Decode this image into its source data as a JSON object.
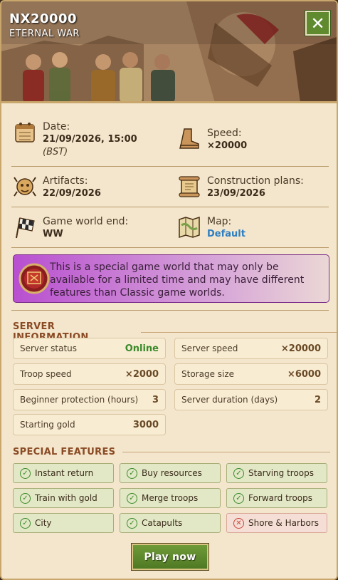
{
  "header": {
    "title": "NX20000",
    "subtitle": "ETERNAL WAR",
    "close_icon": "close-icon",
    "accent": "#5f8a2e"
  },
  "info": {
    "date": {
      "icon": "calendar-icon",
      "label": "Date:",
      "value": "21/09/2026, 15:00",
      "note": "(BST)"
    },
    "speed": {
      "icon": "boot-icon",
      "label": "Speed:",
      "value": "×20000"
    },
    "artifacts": {
      "icon": "artifact-mask-icon",
      "label": "Artifacts:",
      "value": "22/09/2026"
    },
    "construction_plans": {
      "icon": "scroll-icon",
      "label": "Construction plans:",
      "value": "23/09/2026"
    },
    "game_world_end": {
      "icon": "checkered-flag-icon",
      "label": "Game world end:",
      "value": "WW"
    },
    "map": {
      "icon": "map-icon",
      "label": "Map:",
      "value": "Default"
    }
  },
  "special_notice": {
    "icon": "special-world-badge-icon",
    "text": "This is a special game world that may only be available for a limited time and may have different features than Classic game worlds."
  },
  "server_information": {
    "heading": "SERVER INFORMATION",
    "stats": [
      {
        "label": "Server status",
        "value": "Online"
      },
      {
        "label": "Server speed",
        "value": "×20000"
      },
      {
        "label": "Troop speed",
        "value": "×2000"
      },
      {
        "label": "Storage size",
        "value": "×6000"
      },
      {
        "label": "Beginner protection (hours)",
        "value": "3"
      },
      {
        "label": "Server duration (days)",
        "value": "2"
      },
      {
        "label": "Starting gold",
        "value": "3000"
      }
    ]
  },
  "special_features": {
    "heading": "SPECIAL FEATURES",
    "items": [
      {
        "label": "Instant return",
        "enabled": true
      },
      {
        "label": "Buy resources",
        "enabled": true
      },
      {
        "label": "Starving troops",
        "enabled": true
      },
      {
        "label": "Train with gold",
        "enabled": true
      },
      {
        "label": "Merge troops",
        "enabled": true
      },
      {
        "label": "Forward troops",
        "enabled": true
      },
      {
        "label": "City",
        "enabled": true
      },
      {
        "label": "Catapults",
        "enabled": true
      },
      {
        "label": "Shore & Harbors",
        "enabled": false
      }
    ]
  },
  "actions": {
    "play_label": "Play now"
  },
  "colors": {
    "online": "#3a8a2a",
    "link": "#2f7fc2",
    "disabled": "#c8453a"
  }
}
